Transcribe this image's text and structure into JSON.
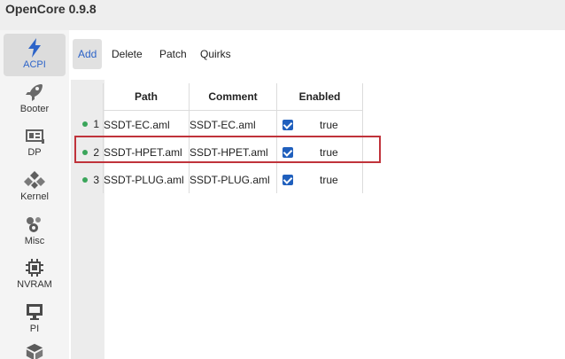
{
  "app": {
    "title": "OpenCore 0.9.8"
  },
  "sidebar": {
    "items": [
      {
        "label": "ACPI",
        "icon": "lightning-icon",
        "active": true
      },
      {
        "label": "Booter",
        "icon": "rocket-icon"
      },
      {
        "label": "DP",
        "icon": "device-properties-icon"
      },
      {
        "label": "Kernel",
        "icon": "kernel-icon"
      },
      {
        "label": "Misc",
        "icon": "misc-icon"
      },
      {
        "label": "NVRAM",
        "icon": "nvram-chip-icon"
      },
      {
        "label": "PI",
        "icon": "platform-info-icon"
      }
    ]
  },
  "tabs": [
    {
      "label": "Add",
      "active": true
    },
    {
      "label": "Delete"
    },
    {
      "label": "Patch"
    },
    {
      "label": "Quirks"
    }
  ],
  "table": {
    "headers": {
      "path": "Path",
      "comment": "Comment",
      "enabled": "Enabled"
    },
    "rows": [
      {
        "num": "1",
        "path": "SSDT-EC.aml",
        "comment": "SSDT-EC.aml",
        "enabled": "true"
      },
      {
        "num": "2",
        "path": "SSDT-HPET.aml",
        "comment": "SSDT-HPET.aml",
        "enabled": "true"
      },
      {
        "num": "3",
        "path": "SSDT-PLUG.aml",
        "comment": "SSDT-PLUG.aml",
        "enabled": "true"
      }
    ]
  },
  "colors": {
    "accent": "#2d64c8",
    "highlight_border": "#c0333b",
    "status_dot": "#3aa55a",
    "checkbox": "#1f5fbd"
  }
}
